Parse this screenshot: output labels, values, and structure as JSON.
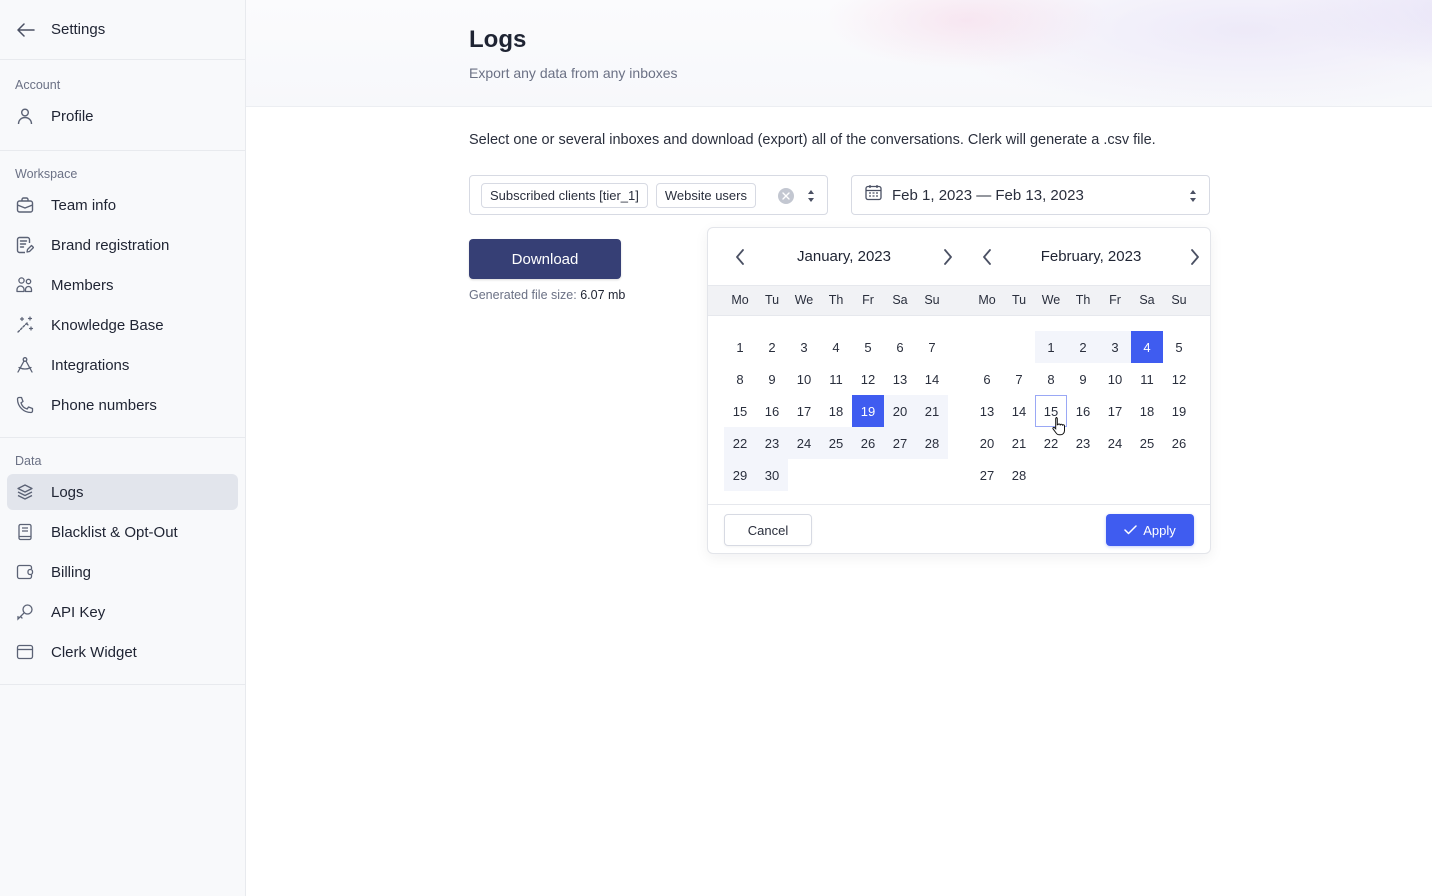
{
  "sidebar": {
    "title": "Settings",
    "back_icon": "arrow-left-icon",
    "sections": [
      {
        "label": "Account",
        "items": [
          {
            "label": "Profile",
            "icon": "user-icon"
          }
        ]
      },
      {
        "label": "Workspace",
        "items": [
          {
            "label": "Team info",
            "icon": "briefcase-icon"
          },
          {
            "label": "Brand registration",
            "icon": "document-edit-icon"
          },
          {
            "label": "Members",
            "icon": "users-icon"
          },
          {
            "label": "Knowledge Base",
            "icon": "magic-wand-icon"
          },
          {
            "label": "Integrations",
            "icon": "compass-icon"
          },
          {
            "label": "Phone numbers",
            "icon": "phone-icon"
          }
        ]
      },
      {
        "label": "Data",
        "items": [
          {
            "label": "Logs",
            "icon": "layers-icon",
            "active": true
          },
          {
            "label": "Blacklist & Opt-Out",
            "icon": "book-icon"
          },
          {
            "label": "Billing",
            "icon": "wallet-icon"
          },
          {
            "label": "API Key",
            "icon": "key-icon"
          },
          {
            "label": "Clerk Widget",
            "icon": "browser-window-icon"
          }
        ]
      }
    ]
  },
  "header": {
    "title": "Logs",
    "subtitle": "Export any data from any inboxes"
  },
  "main": {
    "description": "Select one or several inboxes and download (export) all of the conversations. Clerk will generate a .csv file.",
    "inbox_select": {
      "chips": [
        "Subscribed clients [tier_1]",
        "Website users"
      ]
    },
    "date_range": {
      "value": "Feb 1, 2023 — Feb 13, 2023"
    },
    "download_label": "Download",
    "file_size_label": "Generated file size:",
    "file_size_value": "6.07 mb"
  },
  "date_picker": {
    "weekdays": [
      "Mo",
      "Tu",
      "We",
      "Th",
      "Fr",
      "Sa",
      "Su"
    ],
    "months": [
      {
        "title": "January, 2023",
        "offset": 0,
        "days": 30,
        "selected": [
          19
        ],
        "range": [
          20,
          21,
          22,
          23,
          24,
          25,
          26,
          27,
          28,
          29,
          30
        ],
        "hover": []
      },
      {
        "title": "February, 2023",
        "offset": 2,
        "days": 28,
        "selected": [
          4
        ],
        "range": [
          1,
          2,
          3
        ],
        "hover": [
          15
        ]
      }
    ],
    "cancel_label": "Cancel",
    "apply_label": "Apply"
  },
  "colors": {
    "accent": "#3f5cf0",
    "primary_button": "#363f75",
    "range_fill": "#f3f5fb",
    "active_nav": "#e2e5ec"
  }
}
